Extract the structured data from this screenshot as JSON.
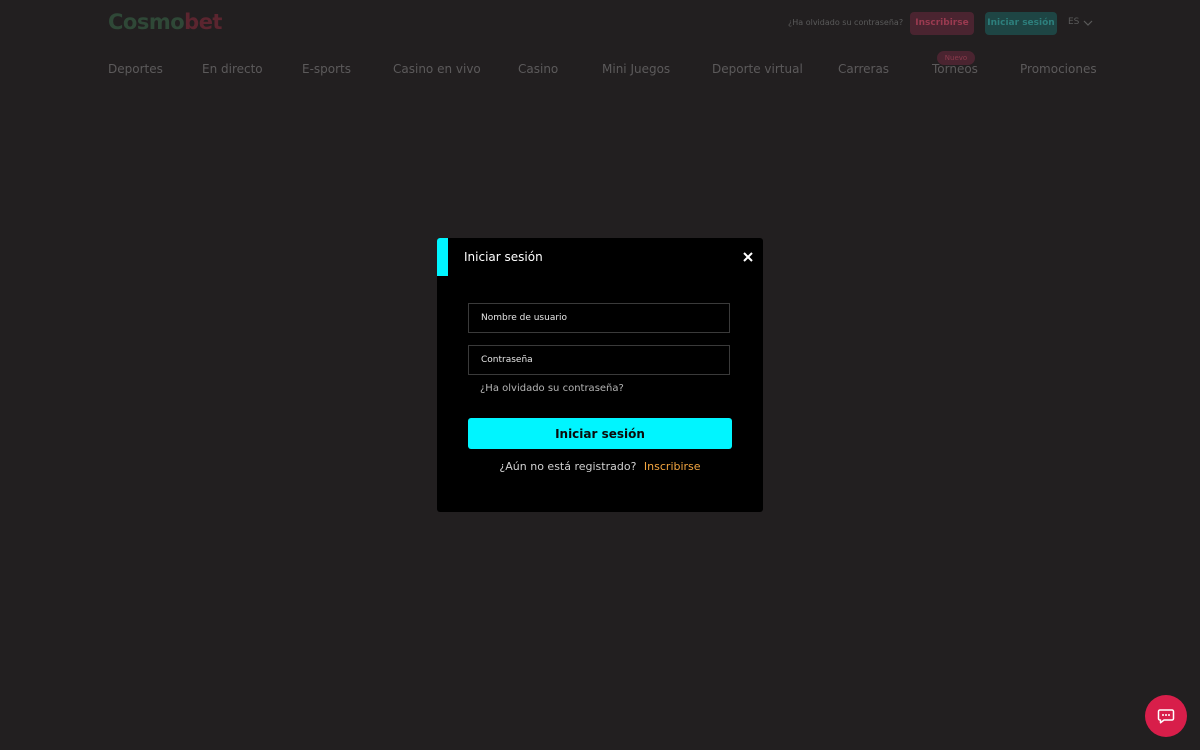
{
  "header": {
    "logo_text": "Cosmobet",
    "logo_part1": "Cosmo",
    "logo_part2": "bet",
    "forgot_password": "¿Ha olvidado su contraseña?",
    "signup_label": "Inscribirse",
    "login_label": "Iniciar sesión",
    "language": "ES"
  },
  "nav": {
    "items": [
      "Deportes",
      "En directo",
      "E-sports",
      "Casino en vivo",
      "Casino",
      "Mini Juegos",
      "Deporte virtual",
      "Carreras",
      "Torneos",
      "Promociones"
    ],
    "badge": "Nuevo"
  },
  "modal": {
    "title": "Iniciar sesión",
    "username_placeholder": "Nombre de usuario",
    "password_placeholder": "Contraseña",
    "forgot_password": "¿Ha olvidado su contraseña?",
    "submit_label": "Iniciar sesión",
    "register_question": "¿Aún no está registrado?",
    "register_link": "Inscribirse"
  },
  "icons": {
    "close": "close-icon",
    "chat": "chat-icon",
    "chevron": "chevron-down-icon"
  },
  "colors": {
    "background": "#221f20",
    "accent": "#00f5ff",
    "link_orange": "#f4a640",
    "chat": "#d81e4a",
    "modal_bg": "#000000"
  }
}
